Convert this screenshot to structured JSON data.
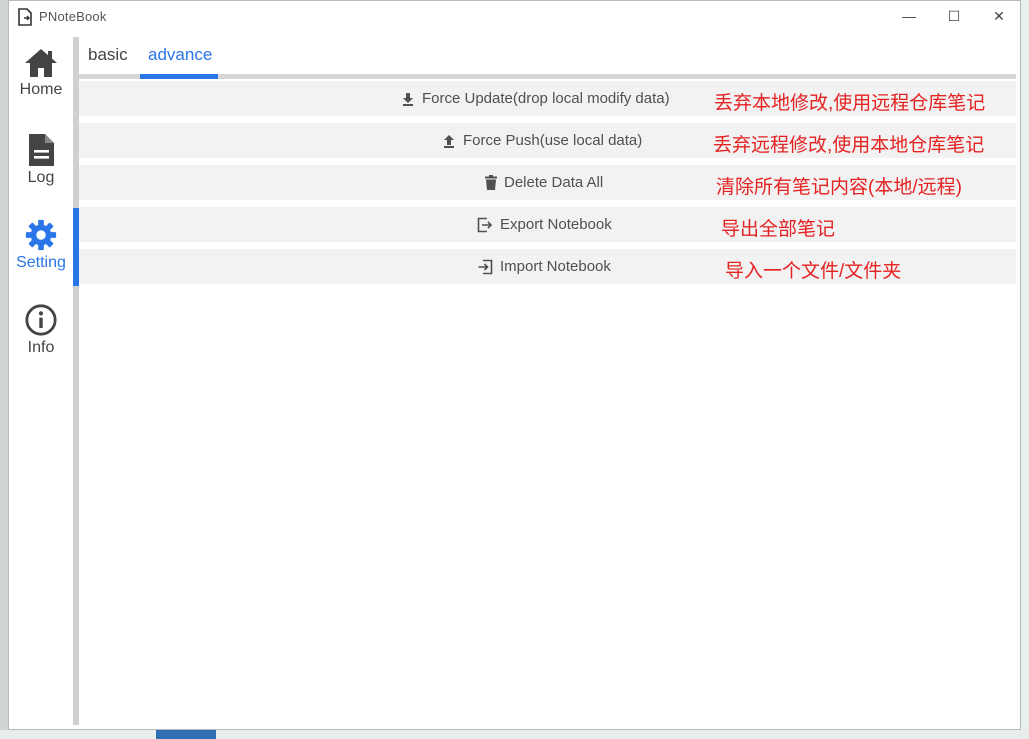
{
  "window": {
    "title": "PNoteBook",
    "controls": {
      "minimize": "—",
      "maximize": "☐",
      "close": "✕"
    }
  },
  "sidebar": {
    "items": [
      {
        "label": "Home",
        "icon": "home-icon"
      },
      {
        "label": "Log",
        "icon": "document-icon"
      },
      {
        "label": "Setting",
        "icon": "gear-icon",
        "active": true
      },
      {
        "label": "Info",
        "icon": "info-icon"
      }
    ]
  },
  "tabs": [
    {
      "label": "basic"
    },
    {
      "label": "advance",
      "active": true
    }
  ],
  "actions": [
    {
      "label": "Force Update(drop local modify data)",
      "icon": "download-icon",
      "note": "丢弃本地修改,使用远程仓库笔记"
    },
    {
      "label": "Force Push(use local data)",
      "icon": "upload-icon",
      "note": "丢弃远程修改,使用本地仓库笔记"
    },
    {
      "label": "Delete Data All",
      "icon": "trash-icon",
      "note": "清除所有笔记内容(本地/远程)"
    },
    {
      "label": "Export Notebook",
      "icon": "export-icon",
      "note": "导出全部笔记"
    },
    {
      "label": "Import Notebook",
      "icon": "import-icon",
      "note": "导入一个文件/文件夹"
    }
  ],
  "colors": {
    "accent": "#2a76e8",
    "annotation": "#e52222",
    "row_bg": "#f2f2f2"
  }
}
